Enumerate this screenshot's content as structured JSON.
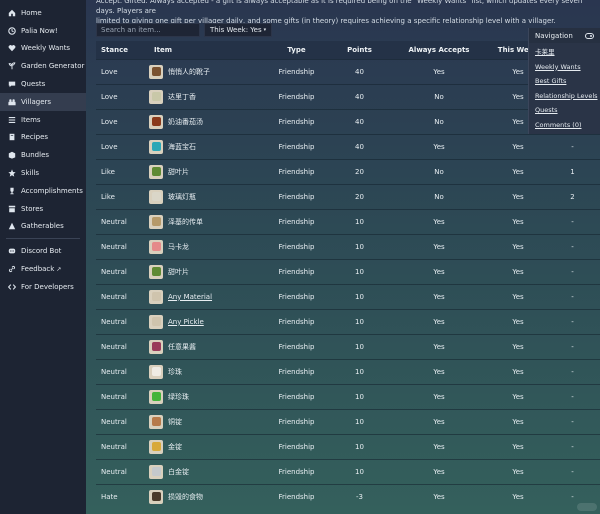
{
  "sidebar": {
    "items": [
      {
        "label": "Home",
        "icon": "home-icon"
      },
      {
        "label": "Palia Now!",
        "icon": "clock-icon"
      },
      {
        "label": "Weekly Wants",
        "icon": "heart-icon"
      },
      {
        "label": "Garden Generator",
        "icon": "sprout-icon"
      },
      {
        "label": "Quests",
        "icon": "chat-icon"
      },
      {
        "label": "Villagers",
        "icon": "people-icon",
        "active": true
      },
      {
        "label": "Items",
        "icon": "list-icon"
      },
      {
        "label": "Recipes",
        "icon": "book-icon"
      },
      {
        "label": "Bundles",
        "icon": "box-icon"
      },
      {
        "label": "Skills",
        "icon": "skills-icon"
      },
      {
        "label": "Accomplishments",
        "icon": "trophy-icon"
      },
      {
        "label": "Stores",
        "icon": "store-icon"
      },
      {
        "label": "Gatherables",
        "icon": "gather-icon"
      }
    ],
    "extra": [
      {
        "label": "Discord Bot",
        "icon": "discord-icon"
      },
      {
        "label": "Feedback",
        "icon": "link-icon",
        "external": true
      },
      {
        "label": "For Developers",
        "icon": "code-icon"
      }
    ]
  },
  "intro": {
    "line1": "Accept. Gifted. Always accepted - a gift is always acceptable as it is required being on the \"Weekly Wants\" list, which updates every seven days. Players are",
    "line2": "limited to giving one gift per villager daily, and some gifts (in theory) requires achieving a specific relationship level with a villager."
  },
  "search": {
    "placeholder": "Search an item..."
  },
  "filter": {
    "label": "This Week: Yes",
    "caret": "▾"
  },
  "table": {
    "headers": [
      "Stance",
      "Item",
      "Type",
      "Points",
      "Always Accepts",
      "This Week",
      ""
    ],
    "rows": [
      {
        "stance": "Love",
        "item": "悄悄人的靴子",
        "type": "Friendship",
        "points": "40",
        "always": "Yes",
        "week": "Yes",
        "extra": "",
        "icon_color": "#7a5230"
      },
      {
        "stance": "Love",
        "item": "达里丁香",
        "type": "Friendship",
        "points": "40",
        "always": "No",
        "week": "Yes",
        "extra": "",
        "icon_color": "#c9c8a8"
      },
      {
        "stance": "Love",
        "item": "奶油番茄汤",
        "type": "Friendship",
        "points": "40",
        "always": "No",
        "week": "Yes",
        "extra": "",
        "icon_color": "#8a3a1c"
      },
      {
        "stance": "Love",
        "item": "海蓝宝石",
        "type": "Friendship",
        "points": "40",
        "always": "Yes",
        "week": "Yes",
        "extra": "-",
        "icon_color": "#2aa7b6"
      },
      {
        "stance": "Like",
        "item": "甜叶片",
        "type": "Friendship",
        "points": "20",
        "always": "No",
        "week": "Yes",
        "extra": "1",
        "icon_color": "#5f8a34"
      },
      {
        "stance": "Like",
        "item": "玻璃灯瓶",
        "type": "Friendship",
        "points": "20",
        "always": "No",
        "week": "Yes",
        "extra": "2",
        "icon_color": "#dad6c8"
      },
      {
        "stance": "Neutral",
        "item": "泽基的传单",
        "type": "Friendship",
        "points": "10",
        "always": "Yes",
        "week": "Yes",
        "extra": "-",
        "icon_color": "#b69a6a"
      },
      {
        "stance": "Neutral",
        "item": "马卡龙",
        "type": "Friendship",
        "points": "10",
        "always": "Yes",
        "week": "Yes",
        "extra": "-",
        "icon_color": "#e58a8a"
      },
      {
        "stance": "Neutral",
        "item": "甜叶片",
        "type": "Friendship",
        "points": "10",
        "always": "Yes",
        "week": "Yes",
        "extra": "-",
        "icon_color": "#5f8a34"
      },
      {
        "stance": "Neutral",
        "item": "Any Material",
        "type": "Friendship",
        "points": "10",
        "always": "Yes",
        "week": "Yes",
        "extra": "-",
        "icon_color": "#cfc4ad",
        "link": true
      },
      {
        "stance": "Neutral",
        "item": "Any Pickle",
        "type": "Friendship",
        "points": "10",
        "always": "Yes",
        "week": "Yes",
        "extra": "-",
        "icon_color": "#cfc4ad",
        "link": true
      },
      {
        "stance": "Neutral",
        "item": "任意果酱",
        "type": "Friendship",
        "points": "10",
        "always": "Yes",
        "week": "Yes",
        "extra": "-",
        "icon_color": "#9a3a5a"
      },
      {
        "stance": "Neutral",
        "item": "珍珠",
        "type": "Friendship",
        "points": "10",
        "always": "Yes",
        "week": "Yes",
        "extra": "-",
        "icon_color": "#efece4"
      },
      {
        "stance": "Neutral",
        "item": "绿珍珠",
        "type": "Friendship",
        "points": "10",
        "always": "Yes",
        "week": "Yes",
        "extra": "-",
        "icon_color": "#43b43a"
      },
      {
        "stance": "Neutral",
        "item": "铜锭",
        "type": "Friendship",
        "points": "10",
        "always": "Yes",
        "week": "Yes",
        "extra": "-",
        "icon_color": "#b77a4a"
      },
      {
        "stance": "Neutral",
        "item": "金锭",
        "type": "Friendship",
        "points": "10",
        "always": "Yes",
        "week": "Yes",
        "extra": "-",
        "icon_color": "#d8a93a"
      },
      {
        "stance": "Neutral",
        "item": "白金锭",
        "type": "Friendship",
        "points": "10",
        "always": "Yes",
        "week": "Yes",
        "extra": "-",
        "icon_color": "#c5c9cc"
      },
      {
        "stance": "Hate",
        "item": "损毁的食物",
        "type": "Friendship",
        "points": "-3",
        "always": "Yes",
        "week": "Yes",
        "extra": "-",
        "icon_color": "#4a3a2a"
      }
    ]
  },
  "navpanel": {
    "title": "Navigation",
    "links": [
      "卡莱里",
      "Weekly Wants",
      "Best Gifts",
      "Relationship Levels",
      "Quests",
      "Comments (0)"
    ]
  }
}
